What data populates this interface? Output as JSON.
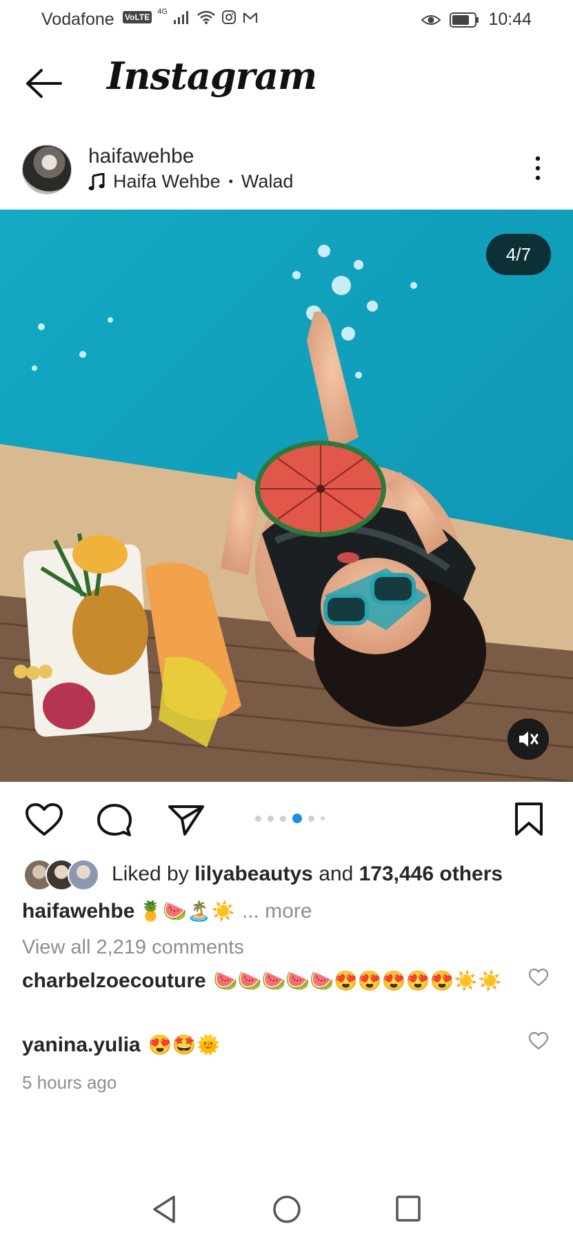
{
  "status_bar": {
    "carrier": "Vodafone",
    "network_badge": "VoLTE",
    "network_type": "4G",
    "time": "10:44"
  },
  "header": {
    "title": "Instagram"
  },
  "post": {
    "username": "haifawehbe",
    "music_artist": "Haifa Wehbe",
    "music_track": "Walad",
    "page_indicator": "4/7",
    "carousel": {
      "total_dots": 6,
      "active_index": 3
    },
    "likes": {
      "prefix": "Liked by",
      "liker": "lilyabeautys",
      "conjunction": "and",
      "others": "173,446 others"
    },
    "caption": {
      "username": "haifawehbe",
      "emojis": "🍍🍉🏝️☀️",
      "more_label": "... more"
    },
    "view_all_comments": "View all 2,219 comments",
    "comments": [
      {
        "username": "charbelzoecouture",
        "text": "🍉🍉🍉🍉🍉😍😍😍😍😍☀️☀️"
      },
      {
        "username": "yanina.yulia",
        "text": "😍🤩🌞"
      }
    ],
    "time_ago": "5 hours ago"
  },
  "colors": {
    "accent_blue": "#1a8fe3",
    "badge_bg": "#0d2f36",
    "muted_text": "#8e8e8e",
    "pool_blue": "#14a9c2"
  }
}
